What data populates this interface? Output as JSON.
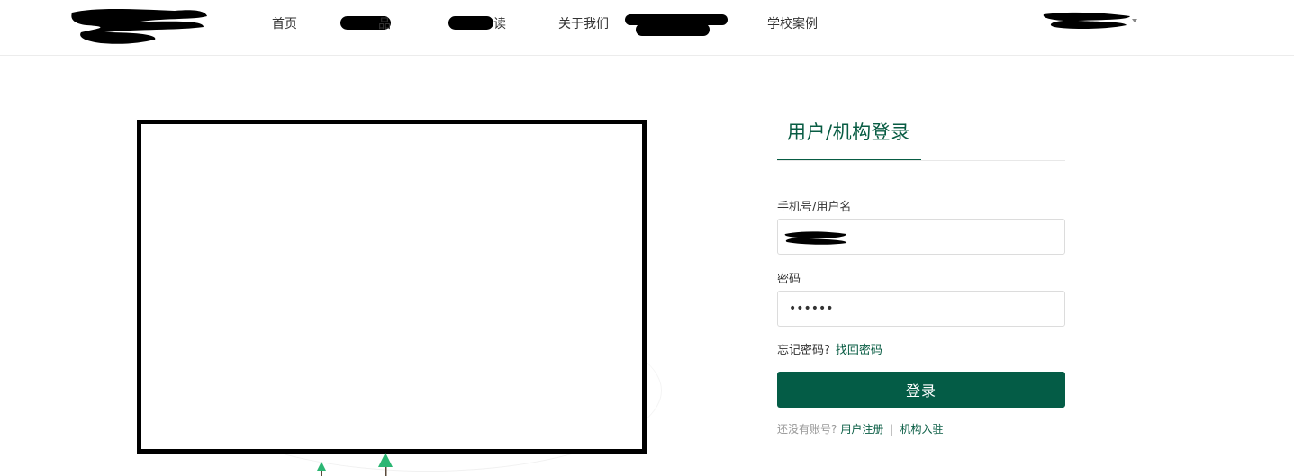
{
  "header": {
    "logo_icon": "redacted-logo",
    "nav": [
      {
        "label": "首页"
      },
      {
        "label": "品"
      },
      {
        "label": "读"
      },
      {
        "label": "关于我们"
      },
      {
        "label": ""
      },
      {
        "label": "学校案例"
      }
    ],
    "user_menu_icon": "chevron-down-icon"
  },
  "login": {
    "tab_label": "用户/机构登录",
    "username_label": "手机号/用户名",
    "username_value": "",
    "password_label": "密码",
    "password_value": "••••••",
    "forgot_text": "忘记密码?",
    "recover_link": "找回密码",
    "submit_label": "登录",
    "no_account_text": "还没有账号?",
    "register_link": "用户注册",
    "separator": "|",
    "org_link": "机构入驻"
  },
  "colors": {
    "brand_green": "#045c46",
    "link_green": "#085c43",
    "tree_green": "#2bb673"
  }
}
